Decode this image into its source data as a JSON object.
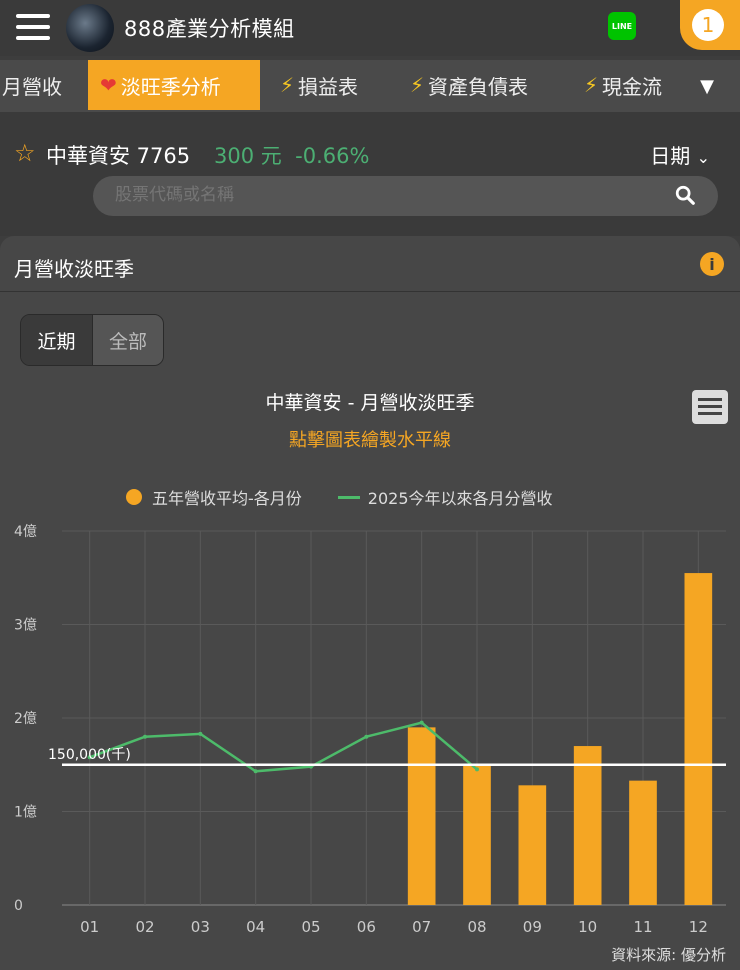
{
  "header": {
    "app_title": "888產業分析模組",
    "line_label": "LINE",
    "notification_count": "1"
  },
  "tabs": [
    {
      "label": "月營收",
      "icon": ""
    },
    {
      "label": "淡旺季分析",
      "icon": "heart-icon",
      "active": true
    },
    {
      "label": "損益表",
      "icon": "bolt-icon"
    },
    {
      "label": "資產負債表",
      "icon": "bolt-icon"
    },
    {
      "label": "現金流",
      "icon": "bolt-icon"
    }
  ],
  "stock": {
    "name": "中華資安 7765",
    "price": "300 元",
    "change": "-0.66%",
    "date_label": "日期",
    "positive_color": "#4caf73"
  },
  "search": {
    "placeholder": "股票代碼或名稱"
  },
  "panel": {
    "title": "月營收淡旺季",
    "range_options": [
      "近期",
      "全部"
    ],
    "selected_range": "近期"
  },
  "source": "資料來源: 優分析",
  "chart_data": {
    "type": "bar",
    "title": "中華資安 - 月營收淡旺季",
    "subtitle": "點擊圖表繪製水平線",
    "categories": [
      "01",
      "02",
      "03",
      "04",
      "05",
      "06",
      "07",
      "08",
      "09",
      "10",
      "11",
      "12"
    ],
    "y_tick_labels": [
      "0",
      "1億",
      "2億",
      "3億",
      "4億"
    ],
    "ylim": [
      0,
      400000
    ],
    "y_unit": "千",
    "legend_placement": "top",
    "grid": true,
    "series": [
      {
        "name": "五年營收平均-各月份",
        "kind": "bar",
        "color": "#f5a623",
        "values": [
          null,
          null,
          null,
          null,
          null,
          null,
          190000,
          150000,
          128000,
          170000,
          133000,
          355000
        ]
      },
      {
        "name": "2025今年以來各月分營收",
        "kind": "line",
        "color": "#4dbb6a",
        "values": [
          158000,
          180000,
          183000,
          143000,
          148000,
          180000,
          195000,
          145000,
          null,
          null,
          null,
          null
        ]
      }
    ],
    "reference_line": {
      "value": 150000,
      "label": "150,000(千)",
      "color": "#ffffff"
    }
  }
}
